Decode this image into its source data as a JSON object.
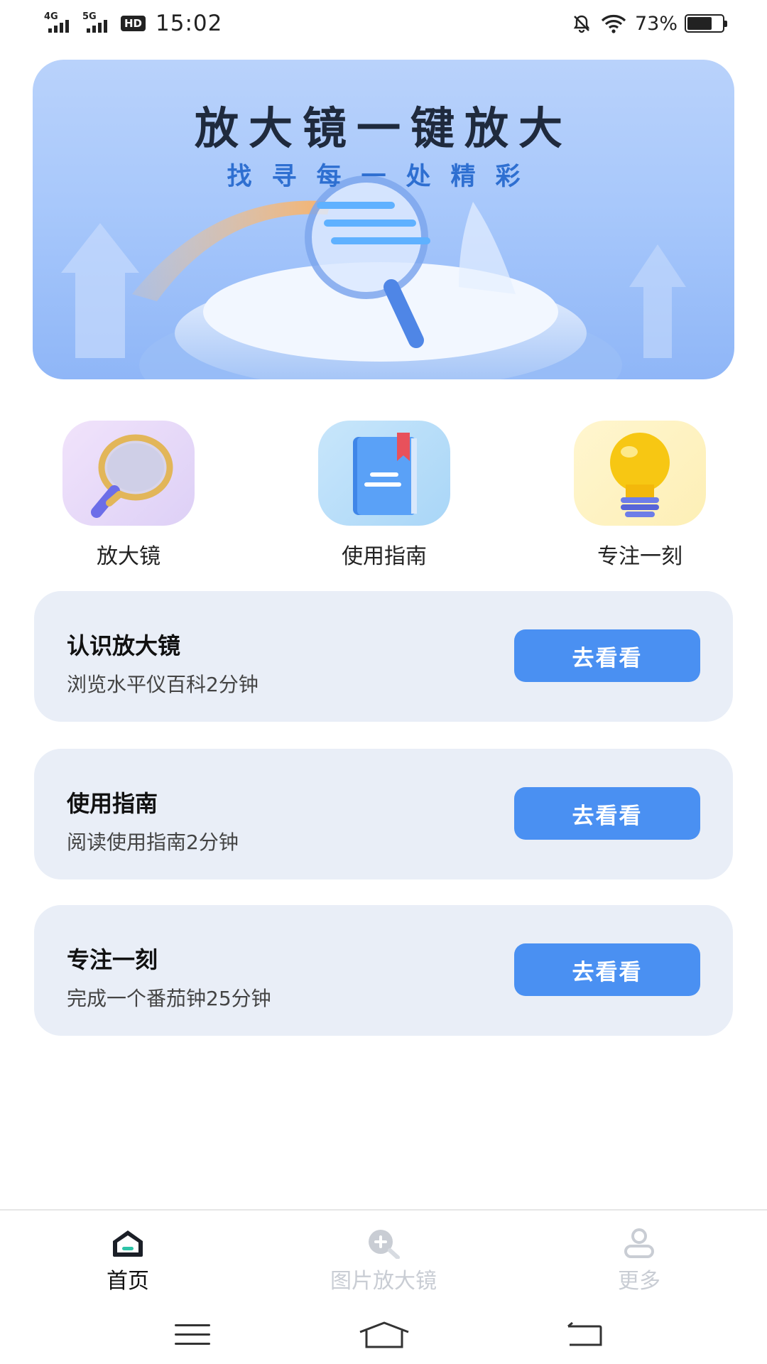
{
  "status_bar": {
    "net1": "4G",
    "net2": "5G",
    "hd": "HD",
    "time": "15:02",
    "battery_pct": "73%",
    "battery_level": 0.73
  },
  "banner": {
    "title": "放大镜一键放大",
    "subtitle": "找寻每一处精彩"
  },
  "shortcuts": [
    {
      "label": "放大镜",
      "icon": "magnifier-icon"
    },
    {
      "label": "使用指南",
      "icon": "book-icon"
    },
    {
      "label": "专注一刻",
      "icon": "lightbulb-icon"
    }
  ],
  "cards": [
    {
      "title": "认识放大镜",
      "desc": "浏览水平仪百科2分钟",
      "button": "去看看"
    },
    {
      "title": "使用指南",
      "desc": "阅读使用指南2分钟",
      "button": "去看看"
    },
    {
      "title": "专注一刻",
      "desc": "完成一个番茄钟25分钟",
      "button": "去看看"
    }
  ],
  "tabbar": {
    "active": "首页",
    "tabs": [
      {
        "label": "首页",
        "icon": "home-icon"
      },
      {
        "label": "图片放大镜",
        "icon": "zoom-in-icon"
      },
      {
        "label": "更多",
        "icon": "user-icon"
      }
    ]
  },
  "colors": {
    "accent": "#4a90f2",
    "card_bg": "#e9eef7",
    "tab_inactive": "#c9cdd4"
  }
}
